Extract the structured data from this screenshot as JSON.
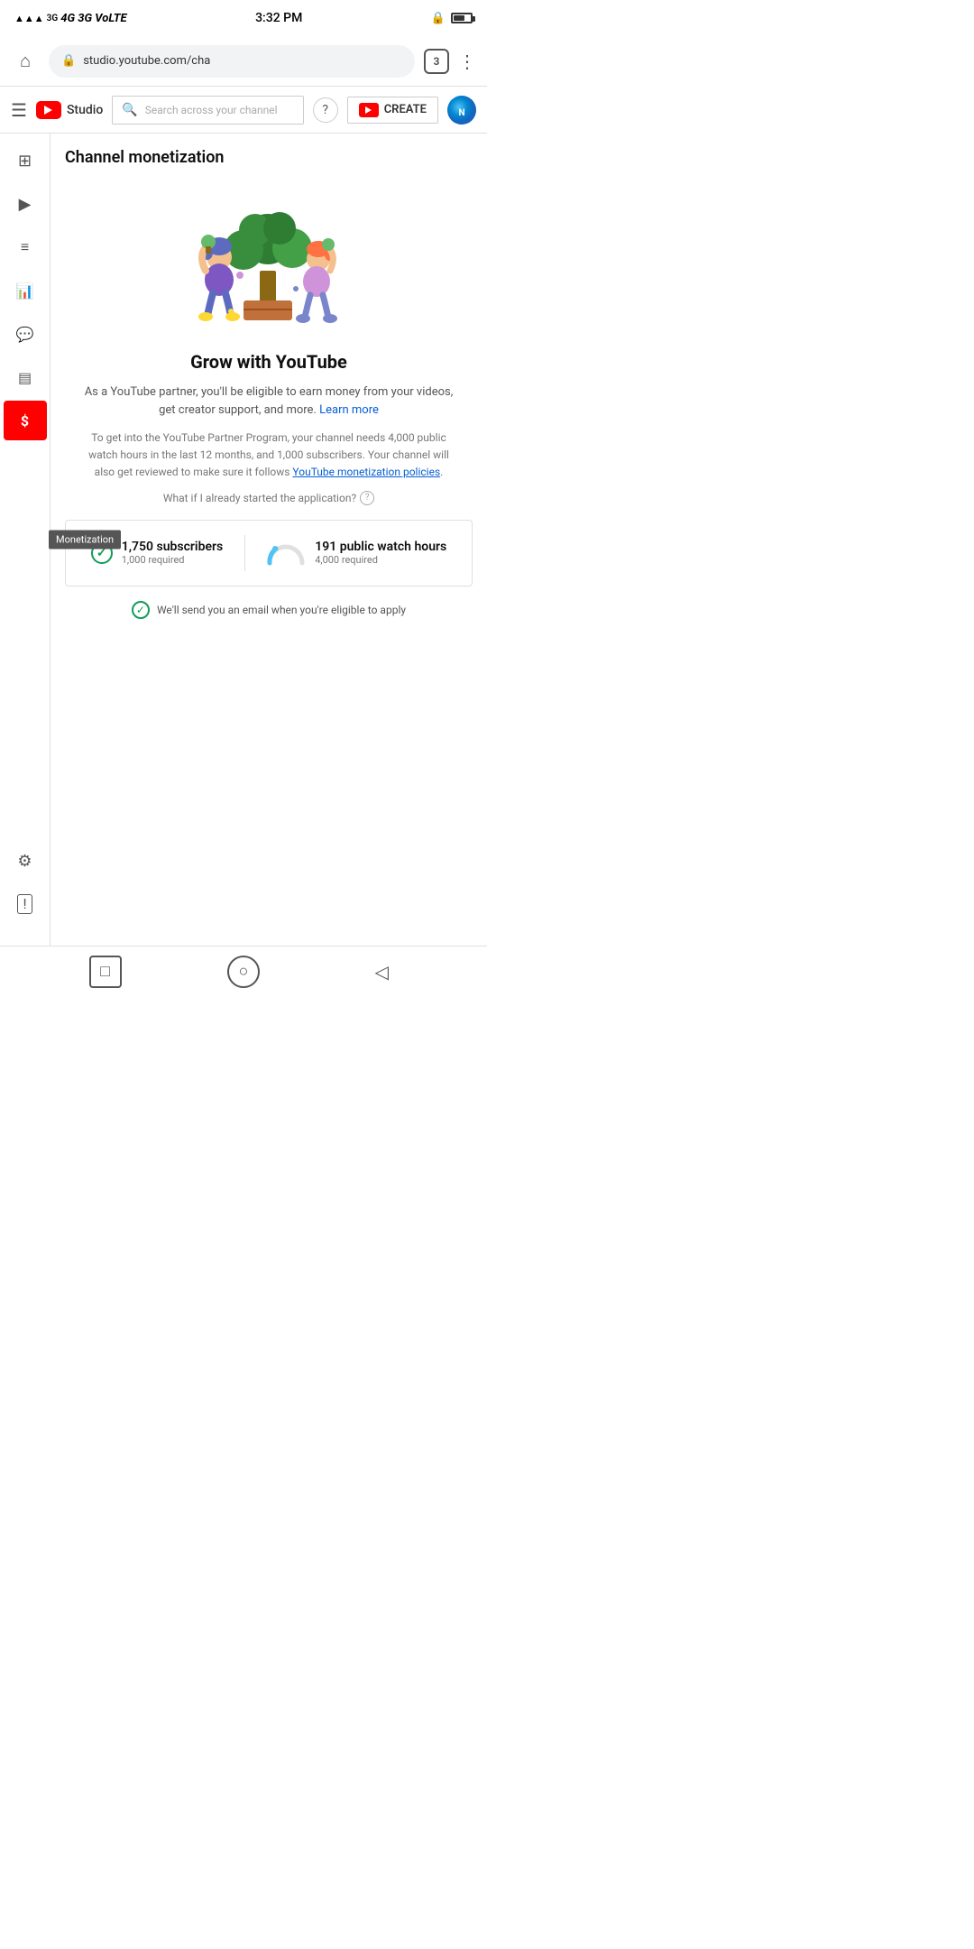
{
  "status_bar": {
    "signal": "4G 3G VoLTE",
    "time": "3:32 PM",
    "lock": "🔒",
    "battery": "60%"
  },
  "browser": {
    "url": "studio.youtube.com/cha",
    "tab_count": "3"
  },
  "header": {
    "logo_text": "Studio",
    "search_placeholder": "Search across your channel",
    "help_label": "?",
    "create_label": "CREATE"
  },
  "sidebar": {
    "items": [
      {
        "id": "menu",
        "icon": "☰",
        "label": "Menu"
      },
      {
        "id": "dashboard",
        "icon": "⊞",
        "label": "Dashboard"
      },
      {
        "id": "content",
        "icon": "▶",
        "label": "Content"
      },
      {
        "id": "playlist",
        "icon": "≡",
        "label": "Playlists"
      },
      {
        "id": "analytics",
        "icon": "📊",
        "label": "Analytics"
      },
      {
        "id": "comments",
        "icon": "💬",
        "label": "Comments"
      },
      {
        "id": "subtitles",
        "icon": "▤",
        "label": "Subtitles"
      },
      {
        "id": "monetization",
        "icon": "$",
        "label": "Monetization",
        "active": true
      }
    ],
    "bottom_items": [
      {
        "id": "settings",
        "icon": "⚙",
        "label": "Settings"
      },
      {
        "id": "feedback",
        "icon": "!",
        "label": "Send Feedback"
      }
    ]
  },
  "page": {
    "title": "Channel monetization",
    "grow_title": "Grow with YouTube",
    "grow_desc": "As a YouTube partner, you'll be eligible to earn money from your videos, get creator support, and more.",
    "learn_more": "Learn more",
    "detail_text": "To get into the YouTube Partner Program, your channel needs 4,000 public watch hours in the last 12 months, and 1,000 subscribers. Your channel will also get reviewed to make sure it follows",
    "yt_policies": "YouTube monetization policies",
    "what_if": "What if I already started the application?",
    "subscribers_count": "1,750 subscribers",
    "subscribers_required": "1,000 required",
    "watch_hours_count": "191 public watch hours",
    "watch_hours_required": "4,000 required",
    "email_notify": "We'll send you an email when you're eligible to apply",
    "tooltip_label": "Monetization"
  }
}
